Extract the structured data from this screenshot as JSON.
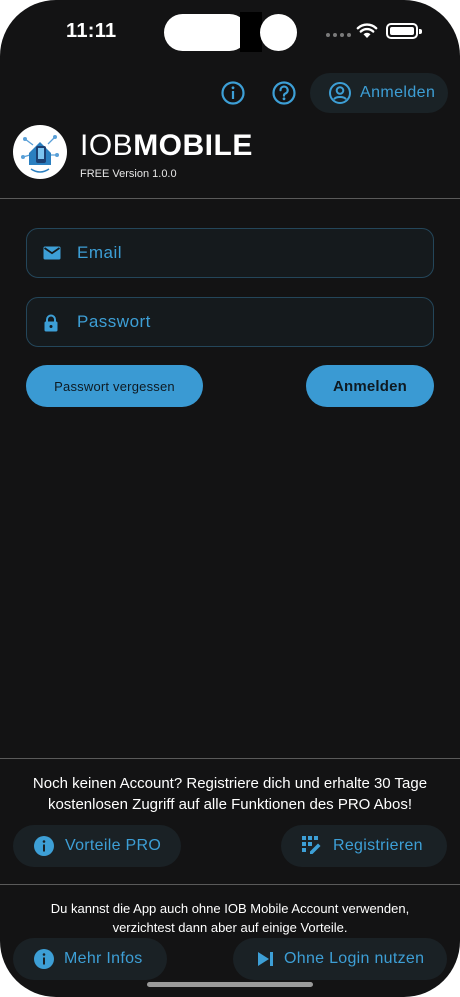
{
  "status_bar": {
    "time": "11:11"
  },
  "header": {
    "info_icon": "info-circle-icon",
    "help_icon": "help-circle-icon",
    "login_label": "Anmelden"
  },
  "brand": {
    "name_light": "IOB",
    "name_bold": "MOBILE",
    "version": "FREE Version 1.0.0"
  },
  "form": {
    "email_placeholder": "Email",
    "password_placeholder": "Passwort",
    "forgot_label": "Passwort vergessen",
    "login_label": "Anmelden"
  },
  "register_section": {
    "text": "Noch keinen Account? Registriere dich und erhalte 30 Tage kostenlosen Zugriff auf alle Funktionen des PRO Abos!",
    "pro_label": "Vorteile PRO",
    "register_label": "Registrieren"
  },
  "guest_section": {
    "text": "Du kannst die App auch ohne IOB Mobile Account verwenden, verzichtest dann aber auf einige Vorteile.",
    "more_label": "Mehr Infos",
    "guest_label": "Ohne Login nutzen"
  },
  "colors": {
    "background": "#131314",
    "accent": "#3a9ad3",
    "chip": "#1a2125"
  }
}
